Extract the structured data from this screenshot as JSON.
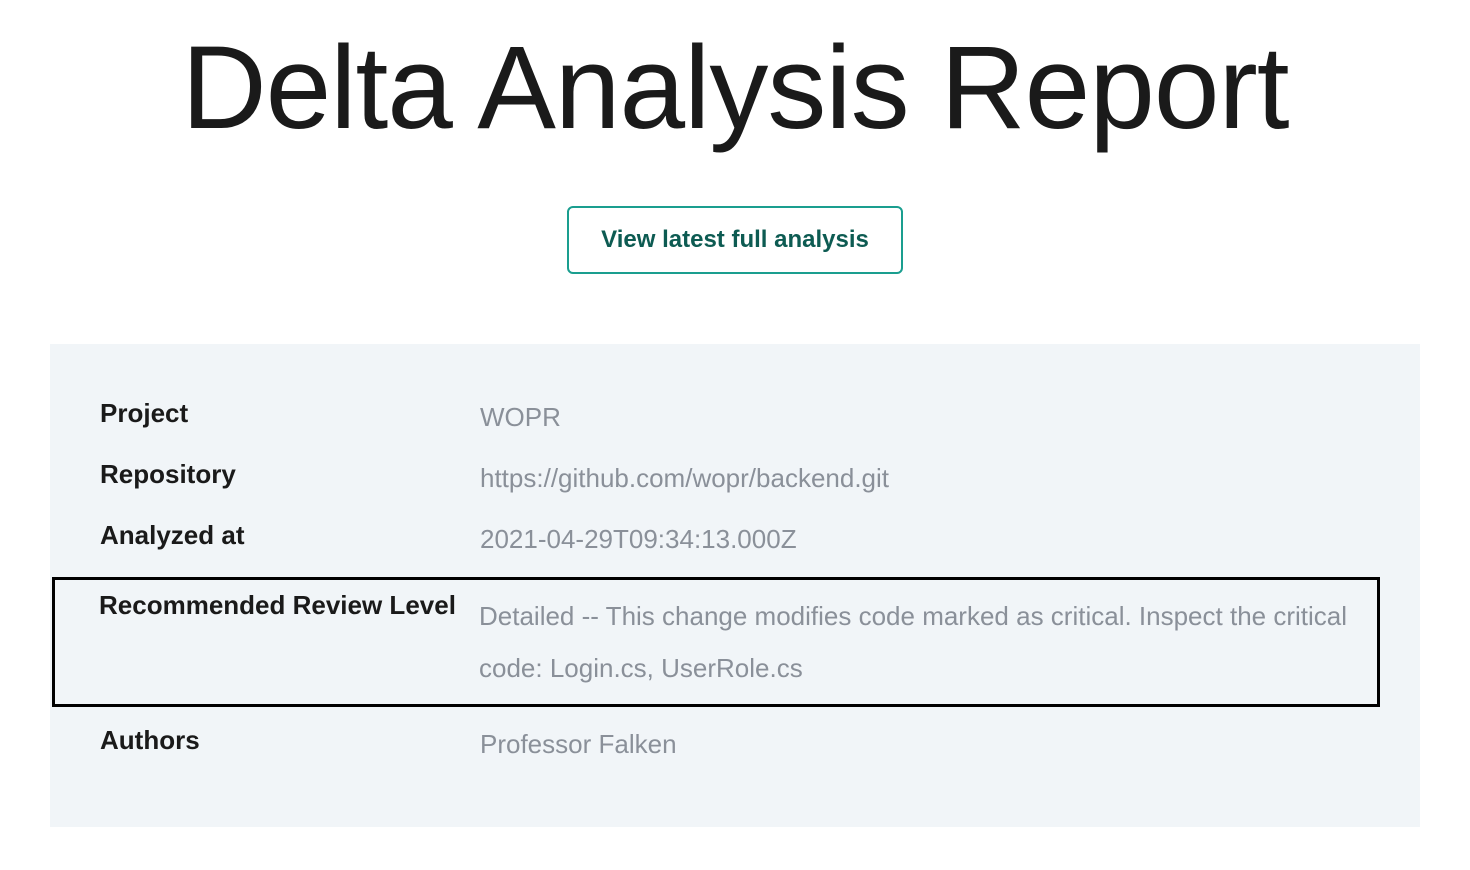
{
  "header": {
    "title": "Delta Analysis Report"
  },
  "actions": {
    "view_analysis_label": "View latest full analysis"
  },
  "details": {
    "rows": [
      {
        "label": "Project",
        "value": "WOPR",
        "highlighted": false
      },
      {
        "label": "Repository",
        "value": "https://github.com/wopr/backend.git",
        "highlighted": false
      },
      {
        "label": "Analyzed at",
        "value": "2021-04-29T09:34:13.000Z",
        "highlighted": false
      },
      {
        "label": "Recommended Review Level",
        "value": "Detailed -- This change modifies code marked as critical. Inspect the critical code: Login.cs, UserRole.cs",
        "highlighted": true
      },
      {
        "label": "Authors",
        "value": "Professor Falken",
        "highlighted": false
      }
    ]
  }
}
